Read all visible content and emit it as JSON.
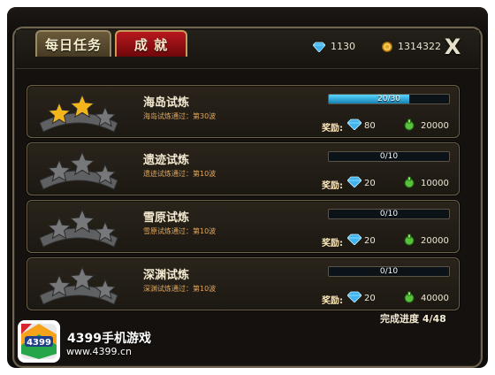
{
  "tabs": {
    "daily": "每日任务",
    "achievement": "成 就"
  },
  "currency": {
    "gems": "1130",
    "coins": "1314322"
  },
  "close_symbol": "X",
  "trials": [
    {
      "title": "海岛试炼",
      "desc": "海岛试炼通过：第30波",
      "progress": "20/30",
      "progress_fraction": 0.667,
      "stars_lit": 2,
      "reward_label": "奖励:",
      "gem_reward": "80",
      "green_reward": "20000"
    },
    {
      "title": "遗迹试炼",
      "desc": "遗迹试炼通过：第10波",
      "progress": "0/10",
      "progress_fraction": 0,
      "stars_lit": 0,
      "reward_label": "奖励:",
      "gem_reward": "20",
      "green_reward": "10000"
    },
    {
      "title": "雪原试炼",
      "desc": "雪原试炼通过：第10波",
      "progress": "0/10",
      "progress_fraction": 0,
      "stars_lit": 0,
      "reward_label": "奖励:",
      "gem_reward": "20",
      "green_reward": "20000"
    },
    {
      "title": "深渊试炼",
      "desc": "深渊试炼通过：第10波",
      "progress": "0/10",
      "progress_fraction": 0,
      "stars_lit": 0,
      "reward_label": "奖励:",
      "gem_reward": "20",
      "green_reward": "40000"
    }
  ],
  "completion": "完成进度 4/48",
  "brand": {
    "logo_text": "4399",
    "name": "4399手机游戏",
    "url": "www.4399.cn"
  },
  "colors": {
    "gold_star": "#f2b51c",
    "grey_star": "#76787a",
    "gem": "#3fb4f0",
    "green_reward": "#58c23c",
    "progress_fill": "#2aa7db"
  }
}
